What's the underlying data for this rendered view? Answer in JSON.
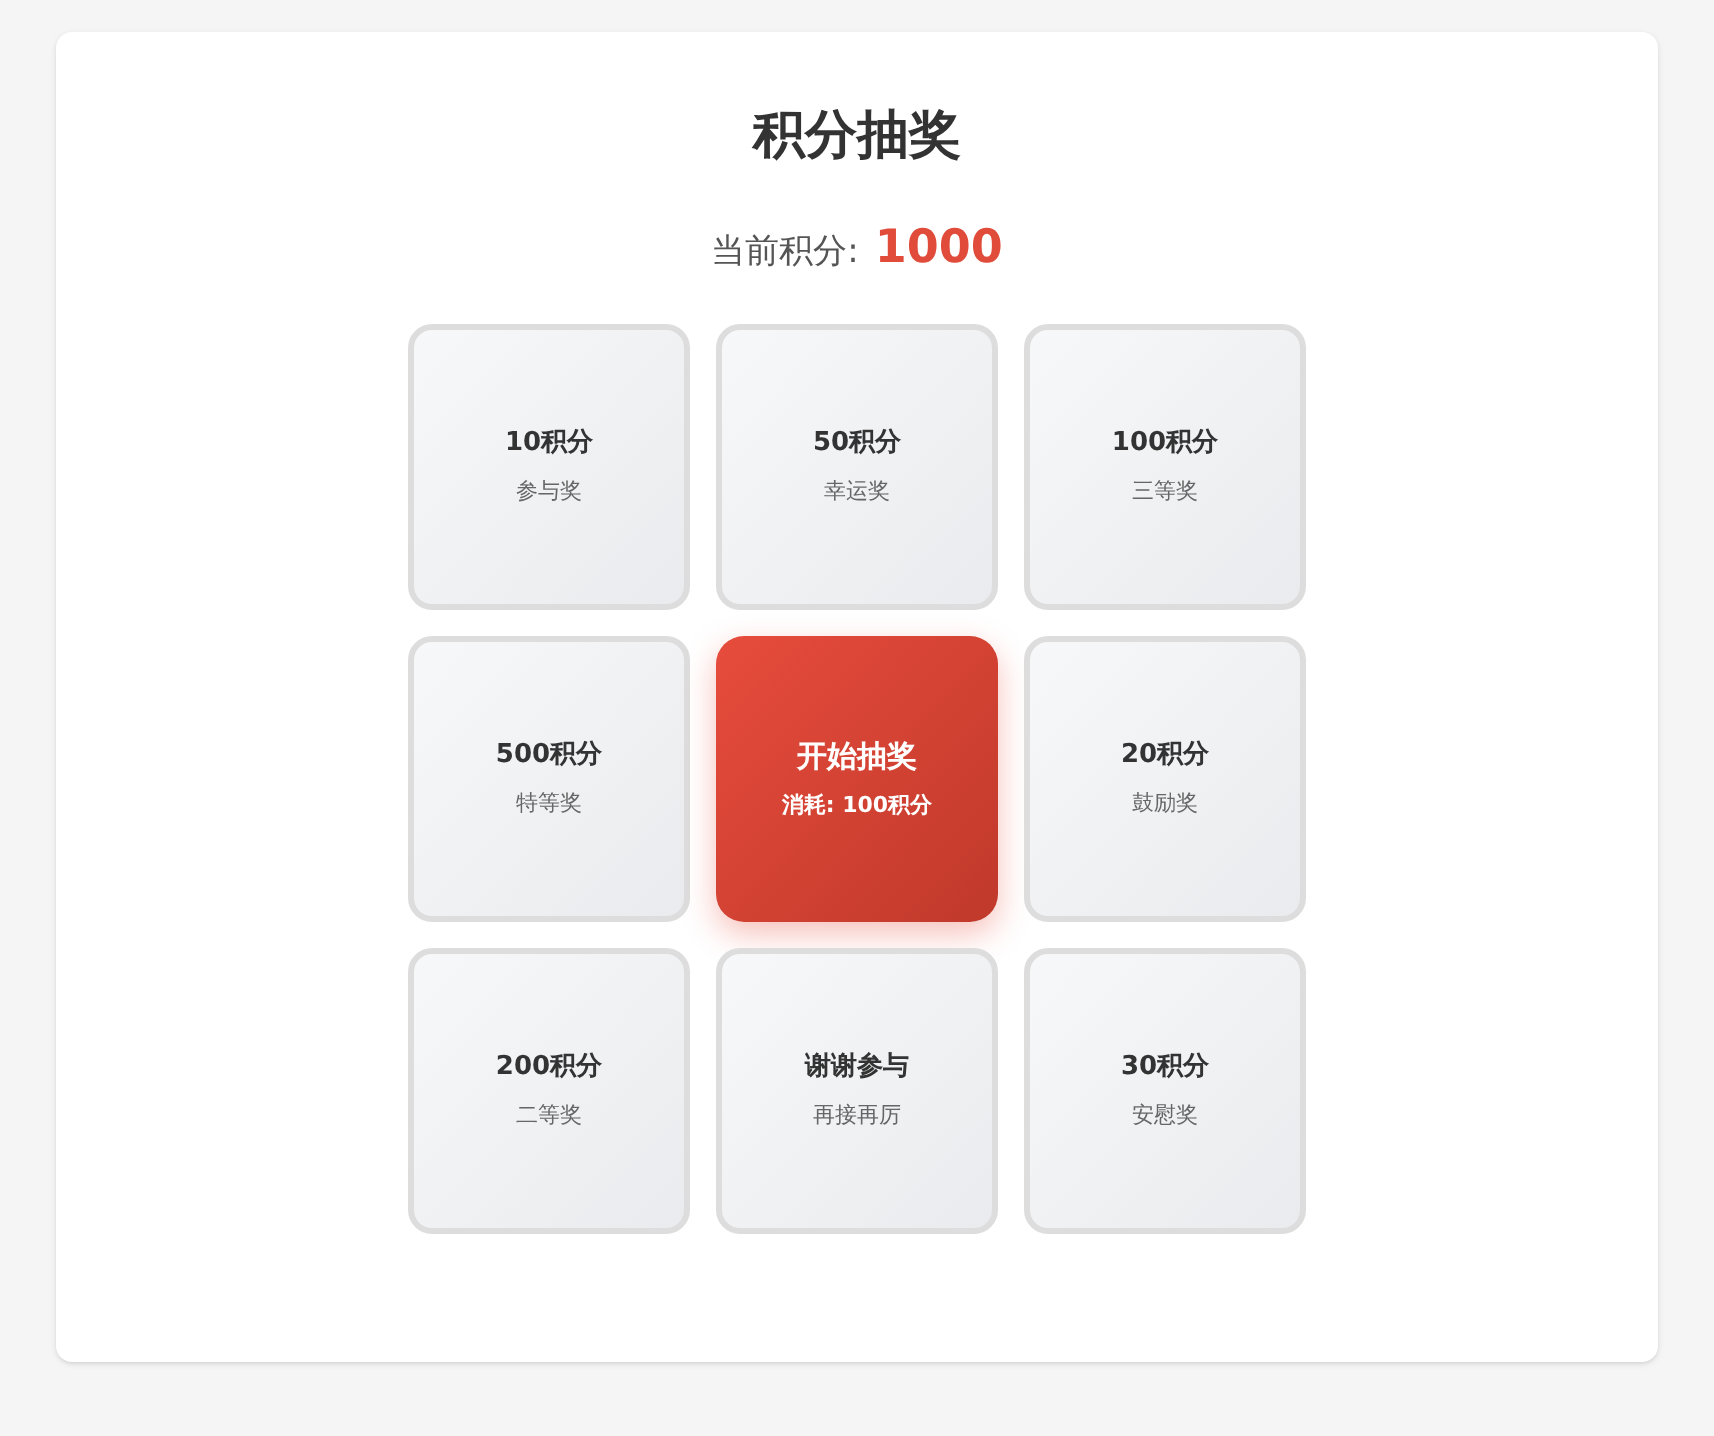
{
  "title": "积分抽奖",
  "points": {
    "label": "当前积分:",
    "value": "1000"
  },
  "grid": [
    {
      "kind": "prize",
      "amount": "10积分",
      "name": "参与奖"
    },
    {
      "kind": "prize",
      "amount": "50积分",
      "name": "幸运奖"
    },
    {
      "kind": "prize",
      "amount": "100积分",
      "name": "三等奖"
    },
    {
      "kind": "prize",
      "amount": "500积分",
      "name": "特等奖"
    },
    {
      "kind": "start",
      "label": "开始抽奖",
      "cost": "消耗: 100积分"
    },
    {
      "kind": "prize",
      "amount": "20积分",
      "name": "鼓励奖"
    },
    {
      "kind": "prize",
      "amount": "200积分",
      "name": "二等奖"
    },
    {
      "kind": "prize",
      "amount": "谢谢参与",
      "name": "再接再厉"
    },
    {
      "kind": "prize",
      "amount": "30积分",
      "name": "安慰奖"
    }
  ]
}
